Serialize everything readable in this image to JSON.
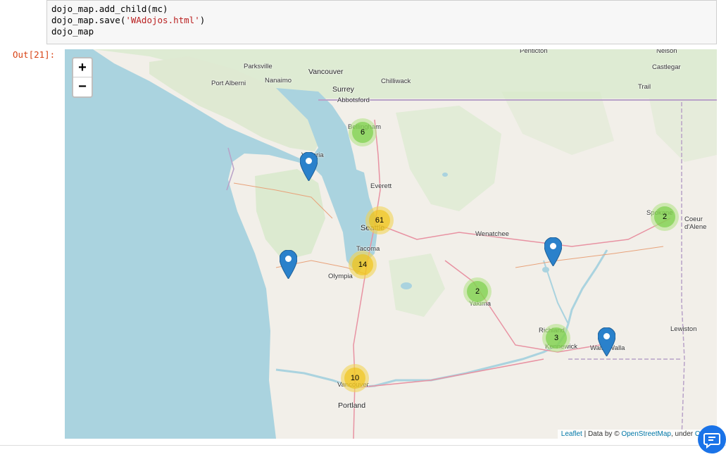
{
  "code": {
    "line1": "dojo_map.add_child(mc)",
    "line2_prefix": "dojo_map.save(",
    "line2_string": "'WAdojos.html'",
    "line2_suffix": ")",
    "line3": "dojo_map"
  },
  "output_prompt": "Out[21]:",
  "map": {
    "zoom_in": "+",
    "zoom_out": "−",
    "places": {
      "penticton": "Penticton",
      "nelson": "Nelson",
      "parksville": "Parksville",
      "vancouver_bc": "Vancouver",
      "castlegar": "Castlegar",
      "nanaimo": "Nanaimo",
      "port_alberni": "Port Alberni",
      "surrey": "Surrey",
      "chilliwack": "Chilliwack",
      "trail": "Trail",
      "abbotsford": "Abbotsford",
      "bellingham": "Bellingham",
      "victoria": "Victoria",
      "everett": "Everett",
      "seattle": "Seattle",
      "wenatchee": "Wenatchee",
      "spokane": "Spokane",
      "coeur_dalene": "Coeur\nd'Alene",
      "tacoma": "Tacoma",
      "olympia": "Olympia",
      "yakima": "Yakima",
      "richland": "Richland",
      "kennewick": "Kennewick",
      "walla_walla": "Walla Walla",
      "lewiston": "Lewiston",
      "vancouver_wa": "Vancouver",
      "portland": "Portland"
    },
    "clusters": {
      "bellingham": "6",
      "seattle": "61",
      "tacoma": "14",
      "yakima": "2",
      "spokane": "2",
      "tri_cities": "3",
      "vancouver": "10"
    },
    "markers": [
      "Port Angeles",
      "Aberdeen",
      "Moses Lake",
      "Walla Walla"
    ],
    "attribution": {
      "leaflet": "Leaflet",
      "sep": " | Data by © ",
      "osm": "OpenStreetMap",
      "under": ", under ",
      "odbl": "ODbL"
    }
  }
}
